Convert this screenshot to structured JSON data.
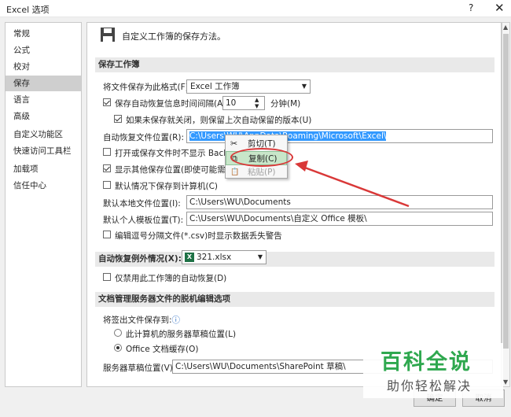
{
  "window": {
    "title": "Excel 选项",
    "help": "?",
    "close": "✕"
  },
  "sidebar": {
    "items": [
      {
        "label": "常规"
      },
      {
        "label": "公式"
      },
      {
        "label": "校对"
      },
      {
        "label": "保存"
      },
      {
        "label": "语言"
      },
      {
        "label": "高级"
      },
      {
        "label": "自定义功能区"
      },
      {
        "label": "快速访问工具栏"
      },
      {
        "label": "加载项"
      },
      {
        "label": "信任中心"
      }
    ],
    "selected": "保存"
  },
  "header": {
    "text": "自定义工作簿的保存方法。"
  },
  "save_wb": {
    "section": "保存工作簿",
    "format_label": "将文件保存为此格式(F):",
    "format_value": "Excel 工作簿",
    "autorecover_label": "保存自动恢复信息时间间隔(A)",
    "autorecover_checked": true,
    "interval": "10",
    "minutes": "分钟(M)",
    "keep_last_label": "如果未保存就关闭，则保留上次自动保留的版本(U)",
    "keep_last_checked": true,
    "ar_location_label": "自动恢复文件位置(R):",
    "ar_location_value": "C:\\Users\\WU\\AppData\\Roaming\\Microsoft\\Excel\\",
    "backstage_label": "打开或保存文件时不显示 Backsta",
    "backstage_checked": false,
    "show_more_label": "显示其他保存位置(即使可能需要登",
    "show_more_checked": true,
    "default_pc_label": "默认情况下保存到计算机(C)",
    "default_pc_checked": false,
    "local_loc_label": "默认本地文件位置(I):",
    "local_loc_value": "C:\\Users\\WU\\Documents",
    "template_label": "默认个人模板位置(T):",
    "template_value": "C:\\Users\\WU\\Documents\\自定义 Office 模板\\",
    "csv_label": "编辑逗号分隔文件(*.csv)时显示数据丢失警告",
    "csv_checked": false
  },
  "autorecover_ex": {
    "section_label": "自动恢复例外情况(X):",
    "workbook": "321.xlsx",
    "disable_label": "仅禁用此工作簿的自动恢复(D)",
    "disable_checked": false
  },
  "offline": {
    "section": "文档管理服务器文件的脱机编辑选项",
    "save_to_label": "将签出文件保存到:",
    "info_icon": "ⓘ",
    "opt1_label": "此计算机的服务器草稿位置(L)",
    "opt1_selected": false,
    "opt2_label": "Office 文档缓存(O)",
    "opt2_selected": true,
    "drafts_label": "服务器草稿位置(V):",
    "drafts_value": "C:\\Users\\WU\\Documents\\SharePoint 草稿\\"
  },
  "context_menu": {
    "items": [
      {
        "label": "剪切(T)",
        "icon": "scissors-icon",
        "glyph": "✂"
      },
      {
        "label": "复制(C)",
        "icon": "copy-icon",
        "glyph": "⧉"
      },
      {
        "label": "粘贴(P)",
        "icon": "paste-icon",
        "glyph": "📋"
      }
    ],
    "highlighted": "复制(C)",
    "disabled": "粘贴(P)"
  },
  "footer": {
    "ok": "确定",
    "cancel": "取消"
  },
  "watermark": {
    "title": "百科全说",
    "subtitle": "助你轻松解决"
  },
  "colors": {
    "accent_green": "#2fa84f",
    "annotation_red": "#d93838",
    "selection_blue": "#3399ff"
  }
}
